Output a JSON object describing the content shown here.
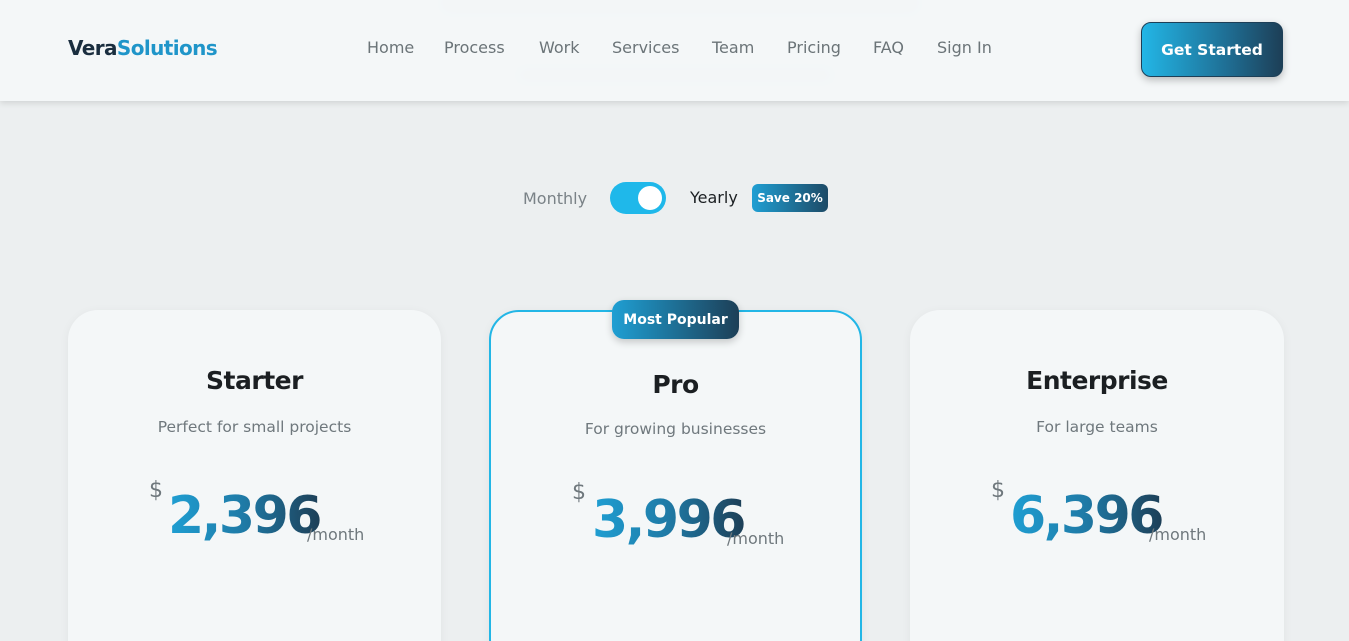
{
  "brand": {
    "part1": "Vera",
    "part2": "Solutions"
  },
  "nav": {
    "items": [
      "Home",
      "Process",
      "Work",
      "Services",
      "Team",
      "Pricing",
      "FAQ",
      "Sign In"
    ]
  },
  "header": {
    "cta_label": "Get Started"
  },
  "billing": {
    "monthly_label": "Monthly",
    "yearly_label": "Yearly",
    "save_badge": "Save 20%",
    "yearly_selected": true
  },
  "plans": [
    {
      "name": "Starter",
      "desc": "Perfect for small projects",
      "currency": "$",
      "price": "2,396",
      "period": "/month",
      "featured": false
    },
    {
      "name": "Pro",
      "desc": "For growing businesses",
      "currency": "$",
      "price": "3,996",
      "period": "/month",
      "featured": true,
      "badge": "Most Popular"
    },
    {
      "name": "Enterprise",
      "desc": "For large teams",
      "currency": "$",
      "price": "6,396",
      "period": "/month",
      "featured": false
    }
  ],
  "colors": {
    "accent": "#22b6e6",
    "brand_dark": "#1d3f57",
    "brand_blue": "#1f95c9"
  }
}
